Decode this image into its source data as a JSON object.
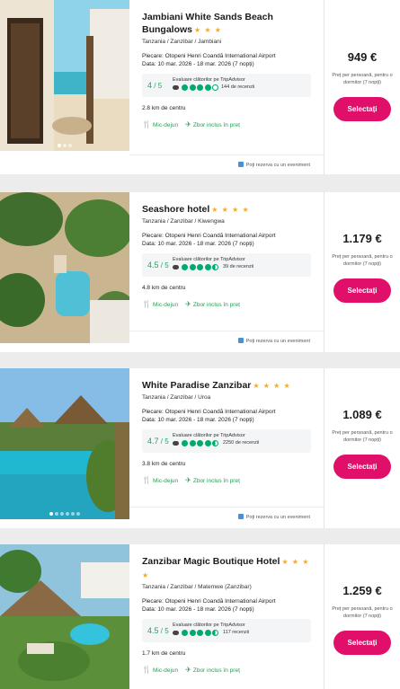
{
  "common": {
    "departure_label": "Plecare: Otopeni Henri Coandă International Airport",
    "date_label": "Data: 10 mar. 2026 - 18 mar. 2026 (7 nopți)",
    "rating_source": "Evaluare clătorilor pe TripAdvisor",
    "breakfast": "Mic-dejun",
    "flight": "Zbor inclus în preț",
    "event_link": "Poți rezerva cu un eveniment",
    "price_note": "Preț per persoană, pentru o dormitor (7 nopți)",
    "select_label": "Selectați",
    "icons": {
      "breakfast": "cutlery-icon",
      "flight": "plane-icon",
      "event": "calendar-icon",
      "tripadvisor": "owl-icon"
    },
    "colors": {
      "accent": "#e0106a",
      "green": "#2a9c55",
      "stars": "#f3a925",
      "rating_bg": "#f4f5f7"
    }
  },
  "hotels": [
    {
      "name": "Jambiani White Sands Beach Bungalows",
      "stars": "★ ★ ★",
      "location": "Tanzania / Zanzibar / Jambiani",
      "rating": "4",
      "rating_max": "/ 5",
      "reviews": "144 de recenzii",
      "distance": "2.8 km de centru",
      "price": "949 €",
      "price_note": "Preț per persoană, pentru o dormitor (7 nopți)"
    },
    {
      "name": "Seashore hotel",
      "stars": "★ ★ ★ ★",
      "location": "Tanzania / Zanzibar / Kiwengwa",
      "rating": "4.5",
      "rating_max": "/ 5",
      "reviews": "39 de recenzii",
      "distance": "4.8 km de centru",
      "price": "1.179 €",
      "price_note": "Preț per persoană, pentru o dormitor (7 nopți)"
    },
    {
      "name": "White Paradise Zanzibar",
      "stars": "★ ★ ★ ★",
      "location": "Tanzania / Zanzibar / Uroa",
      "rating": "4.7",
      "rating_max": "/ 5",
      "reviews": "2250 de recenzii",
      "distance": "3.8 km de centru",
      "price": "1.089 €",
      "price_note": "Preț per persoană, pentru o dormitor (7 nopți)"
    },
    {
      "name": "Zanzibar Magic Boutique Hotel",
      "stars": "★ ★ ★ ★",
      "location": "Tanzania / Zanzibar / Matemwe (Zanzibar)",
      "rating": "4.5",
      "rating_max": "/ 5",
      "reviews": "117 recenzii",
      "distance": "1.7 km de centru",
      "price": "1.259 €",
      "price_note": "Preț per persoană, pentru o dormitor (7 nopți)"
    }
  ]
}
